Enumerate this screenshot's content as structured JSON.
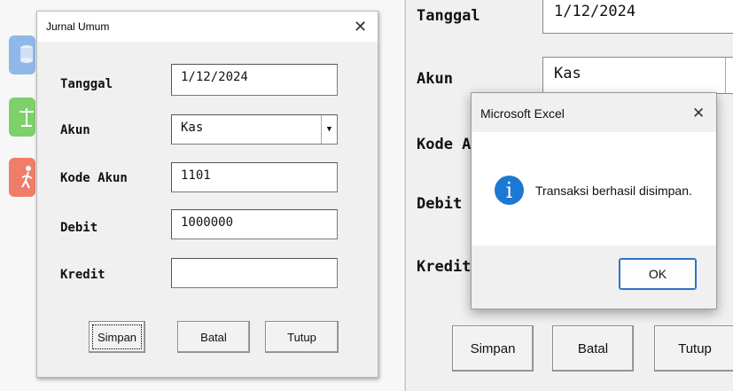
{
  "left_form": {
    "title": "Jurnal Umum",
    "close_glyph": "✕",
    "labels": {
      "tanggal": "Tanggal",
      "akun": "Akun",
      "kode_akun": "Kode Akun",
      "debit": "Debit",
      "kredit": "Kredit"
    },
    "values": {
      "tanggal": "1/12/2024",
      "akun": "Kas",
      "kode_akun": "1101",
      "debit": "1000000",
      "kredit": ""
    },
    "buttons": {
      "simpan": "Simpan",
      "batal": "Batal",
      "tutup": "Tutup"
    }
  },
  "side_icons": [
    {
      "name": "database-icon",
      "color": "#8fb8e8"
    },
    {
      "name": "balance-scale-icon",
      "color": "#7dd06a"
    },
    {
      "name": "walking-person-icon",
      "color": "#f07d6a"
    }
  ],
  "right_form": {
    "labels": {
      "tanggal": "Tanggal",
      "akun": "Akun",
      "kode_akun": "Kode A",
      "debit": "Debit",
      "kredit": "Kredit"
    },
    "values": {
      "tanggal": "1/12/2024",
      "akun": "Kas"
    },
    "buttons": {
      "simpan": "Simpan",
      "batal": "Batal",
      "tutup": "Tutup"
    }
  },
  "message_box": {
    "title": "Microsoft Excel",
    "close_glyph": "✕",
    "message": "Transaksi berhasil disimpan.",
    "icon_glyph": "i",
    "ok_label": "OK",
    "icon_color": "#1c78d4"
  }
}
